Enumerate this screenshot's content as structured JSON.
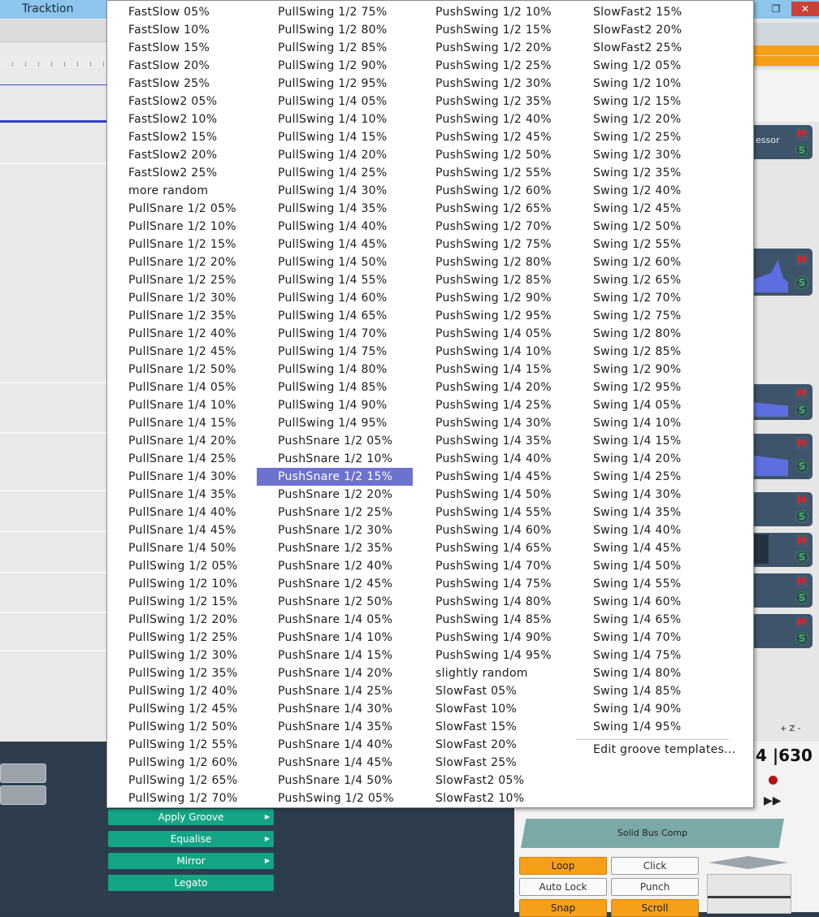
{
  "app": {
    "title": "Tracktion"
  },
  "window_controls": {
    "restore": "❐",
    "close": "✕"
  },
  "track_header_partial": "essor",
  "side_labels": {
    "plus_z": "+ Z -"
  },
  "counter": "4 |630",
  "menu": {
    "columns": [
      [
        "FastSlow 05%",
        "FastSlow 10%",
        "FastSlow 15%",
        "FastSlow 20%",
        "FastSlow 25%",
        "FastSlow2 05%",
        "FastSlow2 10%",
        "FastSlow2 15%",
        "FastSlow2 20%",
        "FastSlow2 25%",
        "more random",
        "PullSnare 1/2 05%",
        "PullSnare 1/2 10%",
        "PullSnare 1/2 15%",
        "PullSnare 1/2 20%",
        "PullSnare 1/2 25%",
        "PullSnare 1/2 30%",
        "PullSnare 1/2 35%",
        "PullSnare 1/2 40%",
        "PullSnare 1/2 45%",
        "PullSnare 1/2 50%",
        "PullSnare 1/4 05%",
        "PullSnare 1/4 10%",
        "PullSnare 1/4 15%",
        "PullSnare 1/4 20%",
        "PullSnare 1/4 25%",
        "PullSnare 1/4 30%",
        "PullSnare 1/4 35%",
        "PullSnare 1/4 40%",
        "PullSnare 1/4 45%",
        "PullSnare 1/4 50%",
        "PullSwing 1/2 05%",
        "PullSwing 1/2 10%",
        "PullSwing 1/2 15%",
        "PullSwing 1/2 20%",
        "PullSwing 1/2 25%",
        "PullSwing 1/2 30%",
        "PullSwing 1/2 35%",
        "PullSwing 1/2 40%",
        "PullSwing 1/2 45%",
        "PullSwing 1/2 50%",
        "PullSwing 1/2 55%",
        "PullSwing 1/2 60%",
        "PullSwing 1/2 65%",
        "PullSwing 1/2 70%"
      ],
      [
        "PullSwing 1/2 75%",
        "PullSwing 1/2 80%",
        "PullSwing 1/2 85%",
        "PullSwing 1/2 90%",
        "PullSwing 1/2 95%",
        "PullSwing 1/4 05%",
        "PullSwing 1/4 10%",
        "PullSwing 1/4 15%",
        "PullSwing 1/4 20%",
        "PullSwing 1/4 25%",
        "PullSwing 1/4 30%",
        "PullSwing 1/4 35%",
        "PullSwing 1/4 40%",
        "PullSwing 1/4 45%",
        "PullSwing 1/4 50%",
        "PullSwing 1/4 55%",
        "PullSwing 1/4 60%",
        "PullSwing 1/4 65%",
        "PullSwing 1/4 70%",
        "PullSwing 1/4 75%",
        "PullSwing 1/4 80%",
        "PullSwing 1/4 85%",
        "PullSwing 1/4 90%",
        "PullSwing 1/4 95%",
        "PushSnare 1/2 05%",
        "PushSnare 1/2 10%",
        "PushSnare 1/2 15%",
        "PushSnare 1/2 20%",
        "PushSnare 1/2 25%",
        "PushSnare 1/2 30%",
        "PushSnare 1/2 35%",
        "PushSnare 1/2 40%",
        "PushSnare 1/2 45%",
        "PushSnare 1/2 50%",
        "PushSnare 1/4 05%",
        "PushSnare 1/4 10%",
        "PushSnare 1/4 15%",
        "PushSnare 1/4 20%",
        "PushSnare 1/4 25%",
        "PushSnare 1/4 30%",
        "PushSnare 1/4 35%",
        "PushSnare 1/4 40%",
        "PushSnare 1/4 45%",
        "PushSnare 1/4 50%",
        "PushSwing 1/2 05%"
      ],
      [
        "PushSwing 1/2 10%",
        "PushSwing 1/2 15%",
        "PushSwing 1/2 20%",
        "PushSwing 1/2 25%",
        "PushSwing 1/2 30%",
        "PushSwing 1/2 35%",
        "PushSwing 1/2 40%",
        "PushSwing 1/2 45%",
        "PushSwing 1/2 50%",
        "PushSwing 1/2 55%",
        "PushSwing 1/2 60%",
        "PushSwing 1/2 65%",
        "PushSwing 1/2 70%",
        "PushSwing 1/2 75%",
        "PushSwing 1/2 80%",
        "PushSwing 1/2 85%",
        "PushSwing 1/2 90%",
        "PushSwing 1/2 95%",
        "PushSwing 1/4 05%",
        "PushSwing 1/4 10%",
        "PushSwing 1/4 15%",
        "PushSwing 1/4 20%",
        "PushSwing 1/4 25%",
        "PushSwing 1/4 30%",
        "PushSwing 1/4 35%",
        "PushSwing 1/4 40%",
        "PushSwing 1/4 45%",
        "PushSwing 1/4 50%",
        "PushSwing 1/4 55%",
        "PushSwing 1/4 60%",
        "PushSwing 1/4 65%",
        "PushSwing 1/4 70%",
        "PushSwing 1/4 75%",
        "PushSwing 1/4 80%",
        "PushSwing 1/4 85%",
        "PushSwing 1/4 90%",
        "PushSwing 1/4 95%",
        "slightly random",
        "SlowFast 05%",
        "SlowFast 10%",
        "SlowFast 15%",
        "SlowFast 20%",
        "SlowFast 25%",
        "SlowFast2 05%",
        "SlowFast2 10%"
      ],
      [
        "SlowFast2 15%",
        "SlowFast2 20%",
        "SlowFast2 25%",
        "Swing 1/2 05%",
        "Swing 1/2 10%",
        "Swing 1/2 15%",
        "Swing 1/2 20%",
        "Swing 1/2 25%",
        "Swing 1/2 30%",
        "Swing 1/2 35%",
        "Swing 1/2 40%",
        "Swing 1/2 45%",
        "Swing 1/2 50%",
        "Swing 1/2 55%",
        "Swing 1/2 60%",
        "Swing 1/2 65%",
        "Swing 1/2 70%",
        "Swing 1/2 75%",
        "Swing 1/2 80%",
        "Swing 1/2 85%",
        "Swing 1/2 90%",
        "Swing 1/2 95%",
        "Swing 1/4 05%",
        "Swing 1/4 10%",
        "Swing 1/4 15%",
        "Swing 1/4 20%",
        "Swing 1/4 25%",
        "Swing 1/4 30%",
        "Swing 1/4 35%",
        "Swing 1/4 40%",
        "Swing 1/4 45%",
        "Swing 1/4 50%",
        "Swing 1/4 55%",
        "Swing 1/4 60%",
        "Swing 1/4 65%",
        "Swing 1/4 70%",
        "Swing 1/4 75%",
        "Swing 1/4 80%",
        "Swing 1/4 85%",
        "Swing 1/4 90%",
        "Swing 1/4 95%"
      ]
    ],
    "selected": "PushSnare 1/2 15%",
    "edit_label": "Edit groove templates..."
  },
  "actions": {
    "apply_groove": "Apply Groove",
    "equalise": "Equalise",
    "mirror": "Mirror",
    "legato": "Legato"
  },
  "transport": {
    "bus_comp": "Solid Bus Comp",
    "loop": "Loop",
    "click": "Click",
    "auto_lock": "Auto Lock",
    "punch": "Punch",
    "snap": "Snap",
    "scroll": "Scroll"
  },
  "track_buttons": {
    "mute": "M",
    "solo": "S"
  },
  "colors": {
    "accent_menu_selection": "#6d72cf",
    "action_green": "#13a585",
    "transport_orange": "#f6a01a",
    "titlebar": "#8dc5ec"
  }
}
